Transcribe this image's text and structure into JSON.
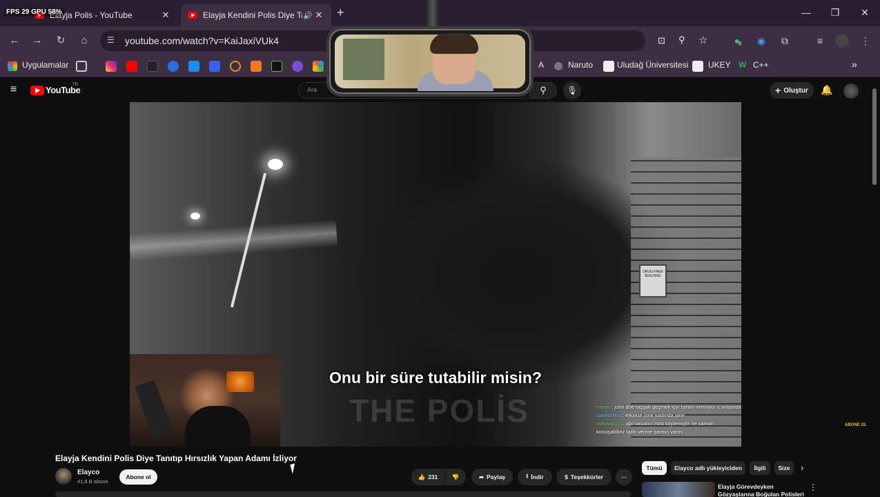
{
  "browser": {
    "overlay_fps": "FPS  29   GPU 58%",
    "tabs": [
      {
        "title": "Elayja Polis - YouTube",
        "active": false
      },
      {
        "title": "Elayja Kendini Polis Diye Tanıtıp",
        "active": true
      }
    ],
    "new_tab": "+",
    "url": "youtube.com/watch?v=KaiJaxiVUk4",
    "extension_badge": "6",
    "bookmarks": [
      "Uygulamalar",
      "A",
      "Naruto",
      "Uludağ Üniversitesi",
      "UKEY",
      "C++"
    ]
  },
  "youtube": {
    "logo_text": "YouTube",
    "logo_region": "TR",
    "search_placeholder": "Ara",
    "create_label": "Oluştur"
  },
  "video": {
    "subtitle": "Onu bir süre tutabilir misin?",
    "watermark": "THE POLİS",
    "sign_text": "DRUG-FREE BUILDING",
    "chat": [
      {
        "user": "miyoto",
        "text": ": john doe taşşak geçmek için ismini vermiyor o anlamda"
      },
      {
        "user": "SavitarMod",
        "text": ": erkekte jone kadında jane"
      },
      {
        "user": "tallhadogn1",
        "text": ": abi nasılsın mod söylemiştir ne zaman konuşabiliriz tarih verme şansın varmı"
      }
    ],
    "abone_badge": "ABONE OL"
  },
  "meta": {
    "title": "Elayja Kendini Polis Diye Tanıtıp Hırsızlık Yapan Adamı İzliyor",
    "channel": "Elayco",
    "subscribers": "41,8 B abone",
    "subscribe": "Abone ol",
    "likes": "231",
    "share": "Paylaş",
    "download": "İndir",
    "thanks": "Teşekkürler"
  },
  "sidebar": {
    "chips": [
      "Tümü",
      "Elayco adlı yükleyiciden",
      "İlgili",
      "Size"
    ],
    "reco_title": "Elayja Görevdeyken Gözyaşlarına Boğulan Polisleri"
  }
}
